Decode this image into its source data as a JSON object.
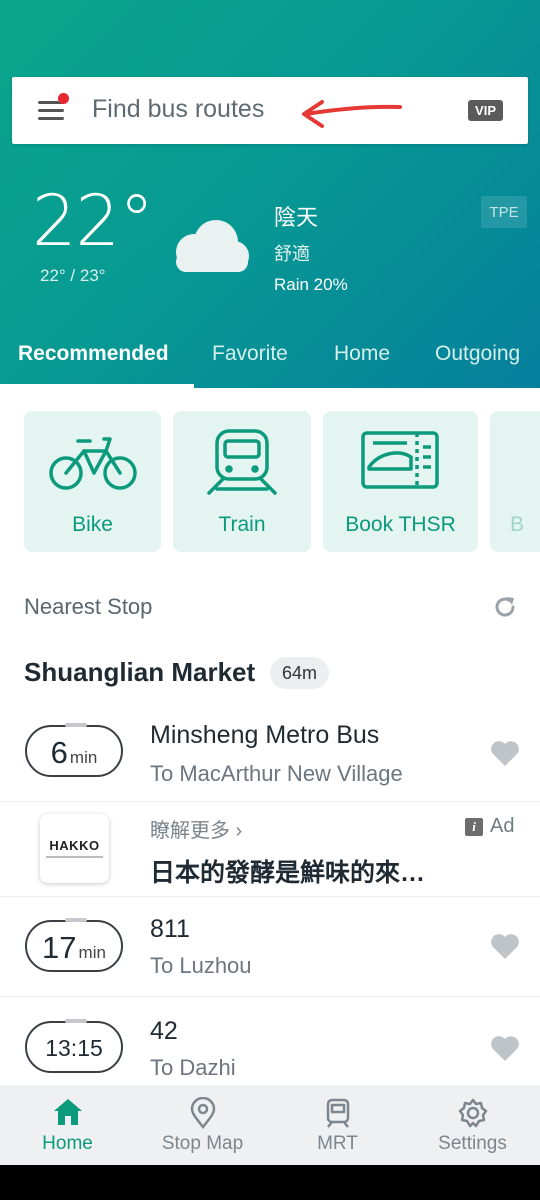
{
  "search": {
    "placeholder": "Find bus routes",
    "vip": "VIP"
  },
  "weather": {
    "temp": "22°",
    "range": "22° / 23°",
    "condition": "陰天",
    "feel": "舒適",
    "rain": "Rain 20%",
    "city": "TPE"
  },
  "tabs": [
    "Recommended",
    "Favorite",
    "Home",
    "Outgoing"
  ],
  "shortcuts": [
    "Bike",
    "Train",
    "Book THSR",
    "B"
  ],
  "nearest": {
    "title": "Nearest Stop",
    "stop_name": "Shuanglian Market",
    "distance": "64m"
  },
  "routes": [
    {
      "eta_num": "6",
      "eta_unit": "min",
      "name": "Minsheng Metro Bus",
      "dest": "To MacArthur New Village"
    },
    {
      "eta_num": "17",
      "eta_unit": "min",
      "name": "811",
      "dest": "To Luzhou"
    },
    {
      "eta_time": "13:15",
      "name": "42",
      "dest": "To Dazhi"
    }
  ],
  "ad": {
    "logo": "HAKKO",
    "more": "瞭解更多 ›",
    "title": "日本的發酵是鮮味的來…",
    "tag": "Ad",
    "info": "i"
  },
  "nav": [
    "Home",
    "Stop Map",
    "MRT",
    "Settings"
  ],
  "colors": {
    "brand": "#0b9a7c",
    "accent_red": "#e8262f"
  }
}
